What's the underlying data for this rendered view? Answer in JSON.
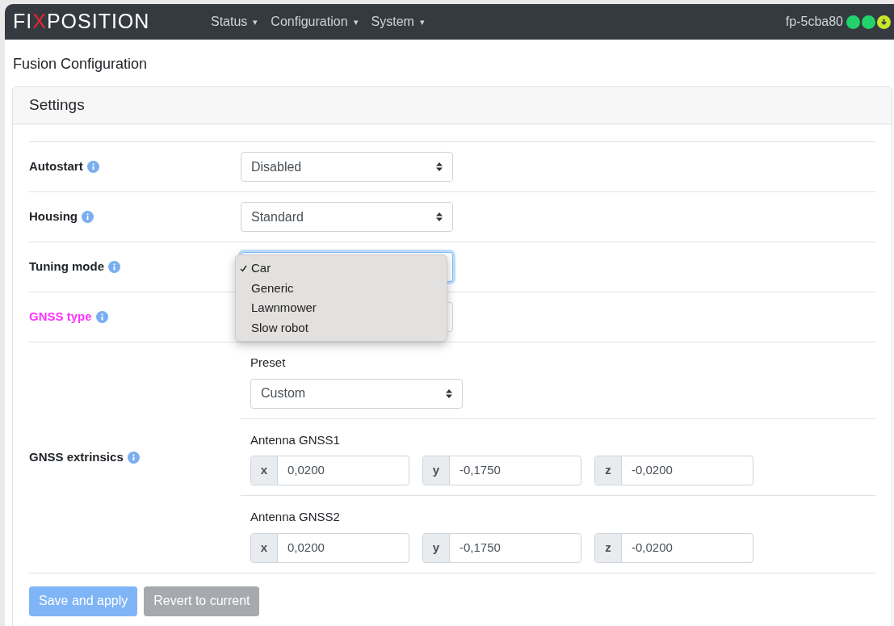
{
  "navbar": {
    "logo": {
      "before": "FI",
      "mark": "X",
      "after": "POSITION"
    },
    "menus": [
      {
        "label": "Status",
        "caret": "▾"
      },
      {
        "label": "Configuration",
        "caret": "▾"
      },
      {
        "label": "System",
        "caret": "▾"
      }
    ],
    "device": "fp-5cba80",
    "status_dots": [
      {
        "color": "#22d36b",
        "kind": "plain"
      },
      {
        "color": "#22d36b",
        "kind": "plain"
      },
      {
        "color": "#c8e62a",
        "kind": "download"
      }
    ]
  },
  "page_title": "Fusion Configuration",
  "card": {
    "title": "Settings",
    "rows": [
      {
        "kind": "select",
        "label": "Autostart",
        "highlighted": false,
        "value": "Disabled",
        "focused": false
      },
      {
        "kind": "select",
        "label": "Housing",
        "highlighted": false,
        "value": "Standard",
        "focused": false
      },
      {
        "kind": "select",
        "label": "Tuning mode",
        "highlighted": false,
        "value": "",
        "focused": true,
        "options": [
          {
            "label": "Car",
            "selected": true
          },
          {
            "label": "Generic",
            "selected": false
          },
          {
            "label": "Lawnmower",
            "selected": false
          },
          {
            "label": "Slow robot",
            "selected": false
          }
        ]
      },
      {
        "kind": "select",
        "label": "GNSS type",
        "highlighted": true,
        "value": "",
        "focused": false
      },
      {
        "kind": "extrinsics",
        "label": "GNSS extrinsics",
        "highlighted": false,
        "preset_label": "Preset",
        "preset_value": "Custom",
        "antennas": [
          {
            "label": "Antenna GNSS1",
            "axes": [
              {
                "axis": "x",
                "value": "0,0200"
              },
              {
                "axis": "y",
                "value": "-0,1750"
              },
              {
                "axis": "z",
                "value": "-0,0200"
              }
            ]
          },
          {
            "label": "Antenna GNSS2",
            "axes": [
              {
                "axis": "x",
                "value": "0,0200"
              },
              {
                "axis": "y",
                "value": "-0,1750"
              },
              {
                "axis": "z",
                "value": "-0,0200"
              }
            ]
          }
        ]
      }
    ]
  },
  "buttons": [
    {
      "label": "Save and apply",
      "kind": "primary",
      "disabled": true
    },
    {
      "label": "Revert to current",
      "kind": "secondary",
      "disabled": true
    }
  ]
}
